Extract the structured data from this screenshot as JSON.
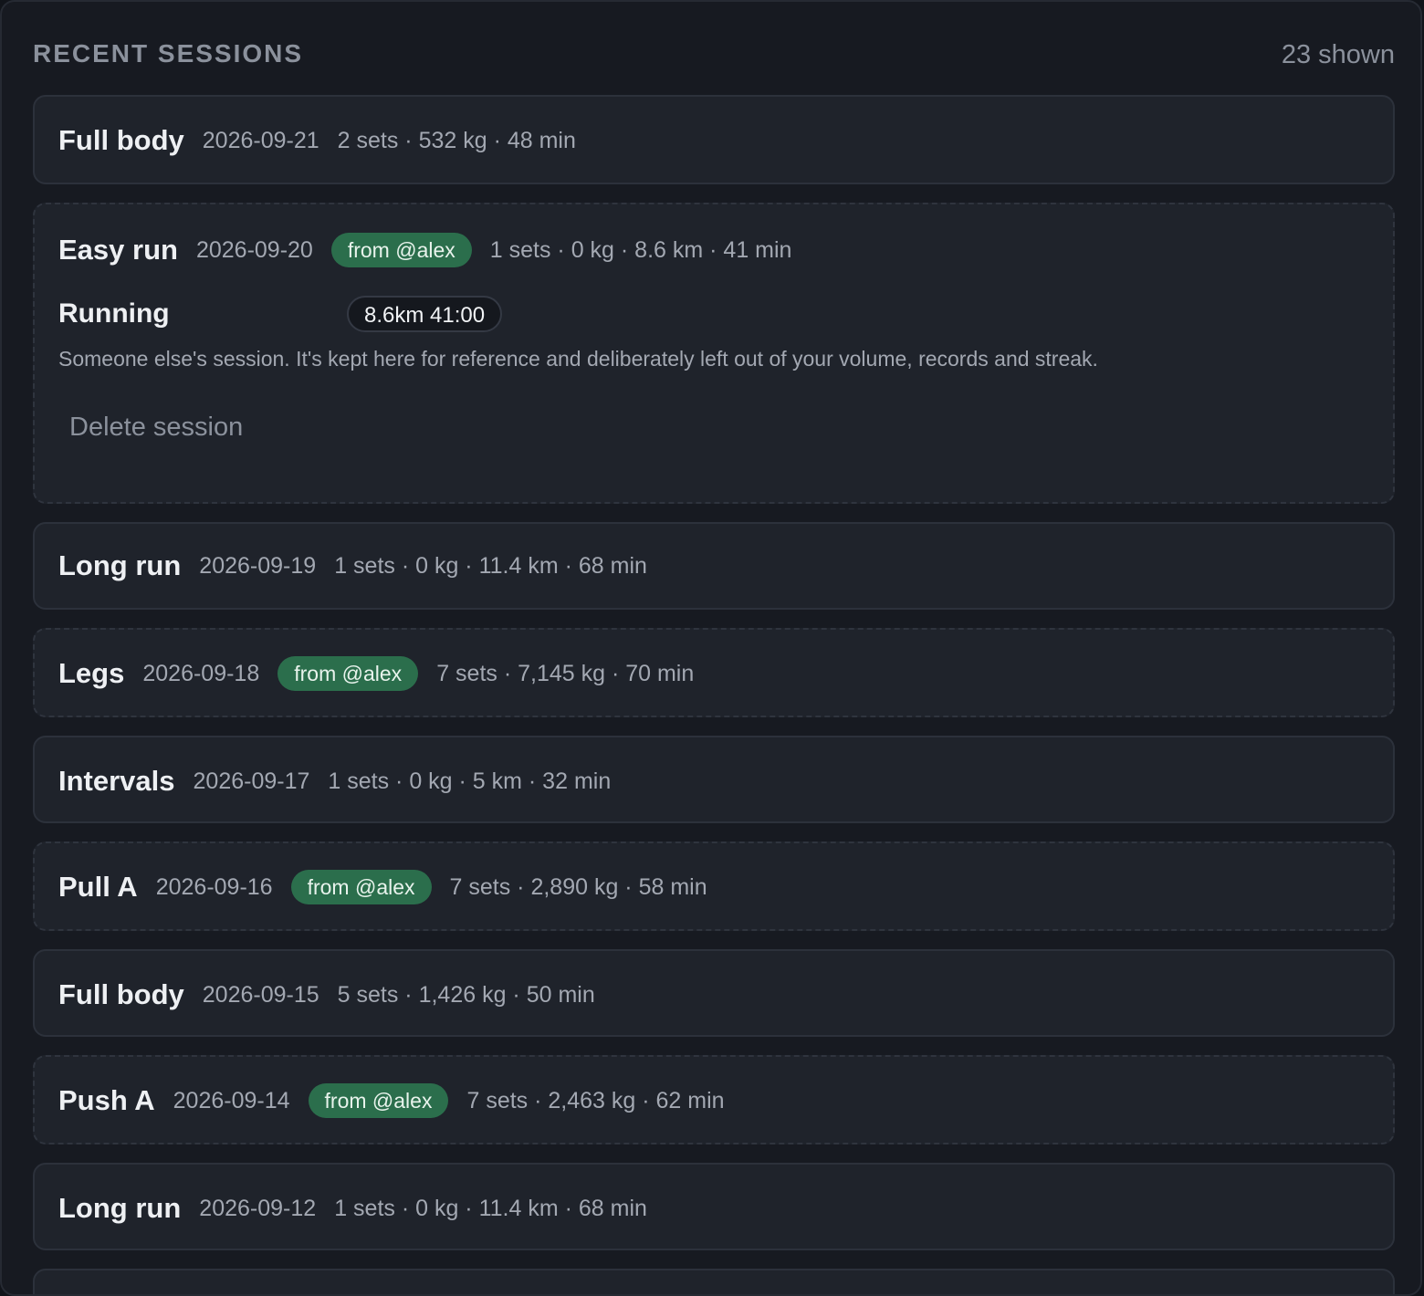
{
  "header": {
    "title": "RECENT SESSIONS",
    "count": "23 shown"
  },
  "sessions": [
    {
      "title": "Full body",
      "date": "2026-09-21",
      "meta": "2 sets · 532 kg · 48 min"
    },
    {
      "title": "Easy run",
      "date": "2026-09-20",
      "badge": "from @alex",
      "meta": "1 sets · 0 kg · 8.6 km · 41 min",
      "detail": {
        "exercise": "Running",
        "pill": "8.6km 41:00",
        "note": "Someone else's session. It's kept here for reference and deliberately left out of your volume, records and streak.",
        "delete_label": "Delete session"
      }
    },
    {
      "title": "Long run",
      "date": "2026-09-19",
      "meta": "1 sets · 0 kg · 11.4 km · 68 min"
    },
    {
      "title": "Legs",
      "date": "2026-09-18",
      "badge": "from @alex",
      "meta": "7 sets · 7,145 kg · 70 min"
    },
    {
      "title": "Intervals",
      "date": "2026-09-17",
      "meta": "1 sets · 0 kg · 5 km · 32 min"
    },
    {
      "title": "Pull A",
      "date": "2026-09-16",
      "badge": "from @alex",
      "meta": "7 sets · 2,890 kg · 58 min"
    },
    {
      "title": "Full body",
      "date": "2026-09-15",
      "meta": "5 sets · 1,426 kg · 50 min"
    },
    {
      "title": "Push A",
      "date": "2026-09-14",
      "badge": "from @alex",
      "meta": "7 sets · 2,463 kg · 62 min"
    },
    {
      "title": "Long run",
      "date": "2026-09-12",
      "meta": "1 sets · 0 kg · 11.4 km · 68 min"
    }
  ]
}
